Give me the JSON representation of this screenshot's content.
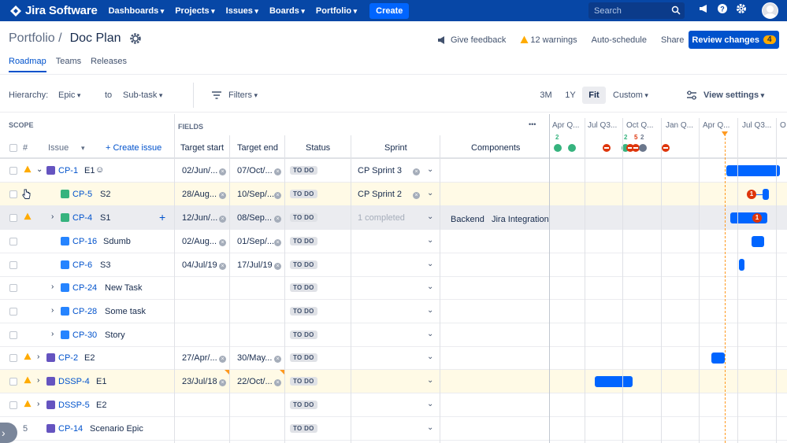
{
  "nav": {
    "product": "Jira Software",
    "menus": [
      "Dashboards",
      "Projects",
      "Issues",
      "Boards",
      "Portfolio"
    ],
    "create": "Create",
    "search_placeholder": "Search"
  },
  "header": {
    "breadcrumb": "Portfolio /",
    "title": "Doc Plan",
    "give_feedback": "Give feedback",
    "warnings": "12 warnings",
    "auto_schedule": "Auto-schedule",
    "share": "Share",
    "review_changes": "Review changes",
    "review_count": "4"
  },
  "tabs": [
    "Roadmap",
    "Teams",
    "Releases"
  ],
  "toolbar": {
    "hierarchy_label": "Hierarchy:",
    "hierarchy_from": "Epic",
    "to": "to",
    "hierarchy_to": "Sub-task",
    "filters": "Filters",
    "zoom": [
      "3M",
      "1Y",
      "Fit",
      "Custom"
    ],
    "view_settings": "View settings"
  },
  "columns": {
    "scope": "SCOPE",
    "fields": "FIELDS",
    "more": "•••",
    "hash": "#",
    "issue": "Issue",
    "create_issue": "+ Create issue",
    "target_start": "Target start",
    "target_end": "Target end",
    "status": "Status",
    "sprint": "Sprint",
    "components": "Components"
  },
  "timeline": {
    "headers": [
      "Apr Q...",
      "Jul Q3...",
      "Oct Q...",
      "Jan Q...",
      "Apr Q...",
      "Jul Q3...",
      "O"
    ],
    "markers": [
      "2",
      "2",
      "5",
      "2"
    ]
  },
  "rows": [
    {
      "key": "CP-1",
      "summary": "E1",
      "start": "02/Jun/...",
      "end": "07/Oct/...",
      "status": "TO DO",
      "sprint": "CP Sprint 3",
      "components": ""
    },
    {
      "key": "CP-5",
      "summary": "S2",
      "start": "28/Aug...",
      "end": "10/Sep/...",
      "status": "TO DO",
      "sprint": "CP Sprint 2",
      "components": "",
      "badge": "1"
    },
    {
      "key": "CP-4",
      "summary": "S1",
      "start": "12/Jun/...",
      "end": "08/Sep...",
      "status": "TO DO",
      "sprint": "1 completed",
      "components": "Backend   Jira Integration",
      "badge": "1"
    },
    {
      "key": "CP-16",
      "summary": "Sdumb",
      "start": "02/Aug...",
      "end": "01/Sep/...",
      "status": "TO DO",
      "sprint": "",
      "components": ""
    },
    {
      "key": "CP-6",
      "summary": "S3",
      "start": "04/Jul/19",
      "end": "17/Jul/19",
      "status": "TO DO",
      "sprint": "",
      "components": ""
    },
    {
      "key": "CP-24",
      "summary": "New Task",
      "start": "",
      "end": "",
      "status": "TO DO",
      "sprint": "",
      "components": ""
    },
    {
      "key": "CP-28",
      "summary": "Some task",
      "start": "",
      "end": "",
      "status": "TO DO",
      "sprint": "",
      "components": ""
    },
    {
      "key": "CP-30",
      "summary": "Story",
      "start": "",
      "end": "",
      "status": "TO DO",
      "sprint": "",
      "components": ""
    },
    {
      "key": "CP-2",
      "summary": "E2",
      "start": "27/Apr/...",
      "end": "30/May...",
      "status": "TO DO",
      "sprint": "",
      "components": ""
    },
    {
      "key": "DSSP-4",
      "summary": "E1",
      "start": "23/Jul/18",
      "end": "22/Oct/...",
      "status": "TO DO",
      "sprint": "",
      "components": ""
    },
    {
      "key": "DSSP-5",
      "summary": "E2",
      "start": "",
      "end": "",
      "status": "TO DO",
      "sprint": "",
      "components": ""
    },
    {
      "key": "CP-14",
      "summary": "Scenario Epic",
      "rank": "5",
      "start": "",
      "end": "",
      "status": "TO DO",
      "sprint": "",
      "components": ""
    }
  ],
  "colors": {
    "nav": "#0747a6",
    "primary": "#0052cc",
    "bar": "#0065ff",
    "warning": "#ffab00",
    "highlight": "#fffae6"
  }
}
